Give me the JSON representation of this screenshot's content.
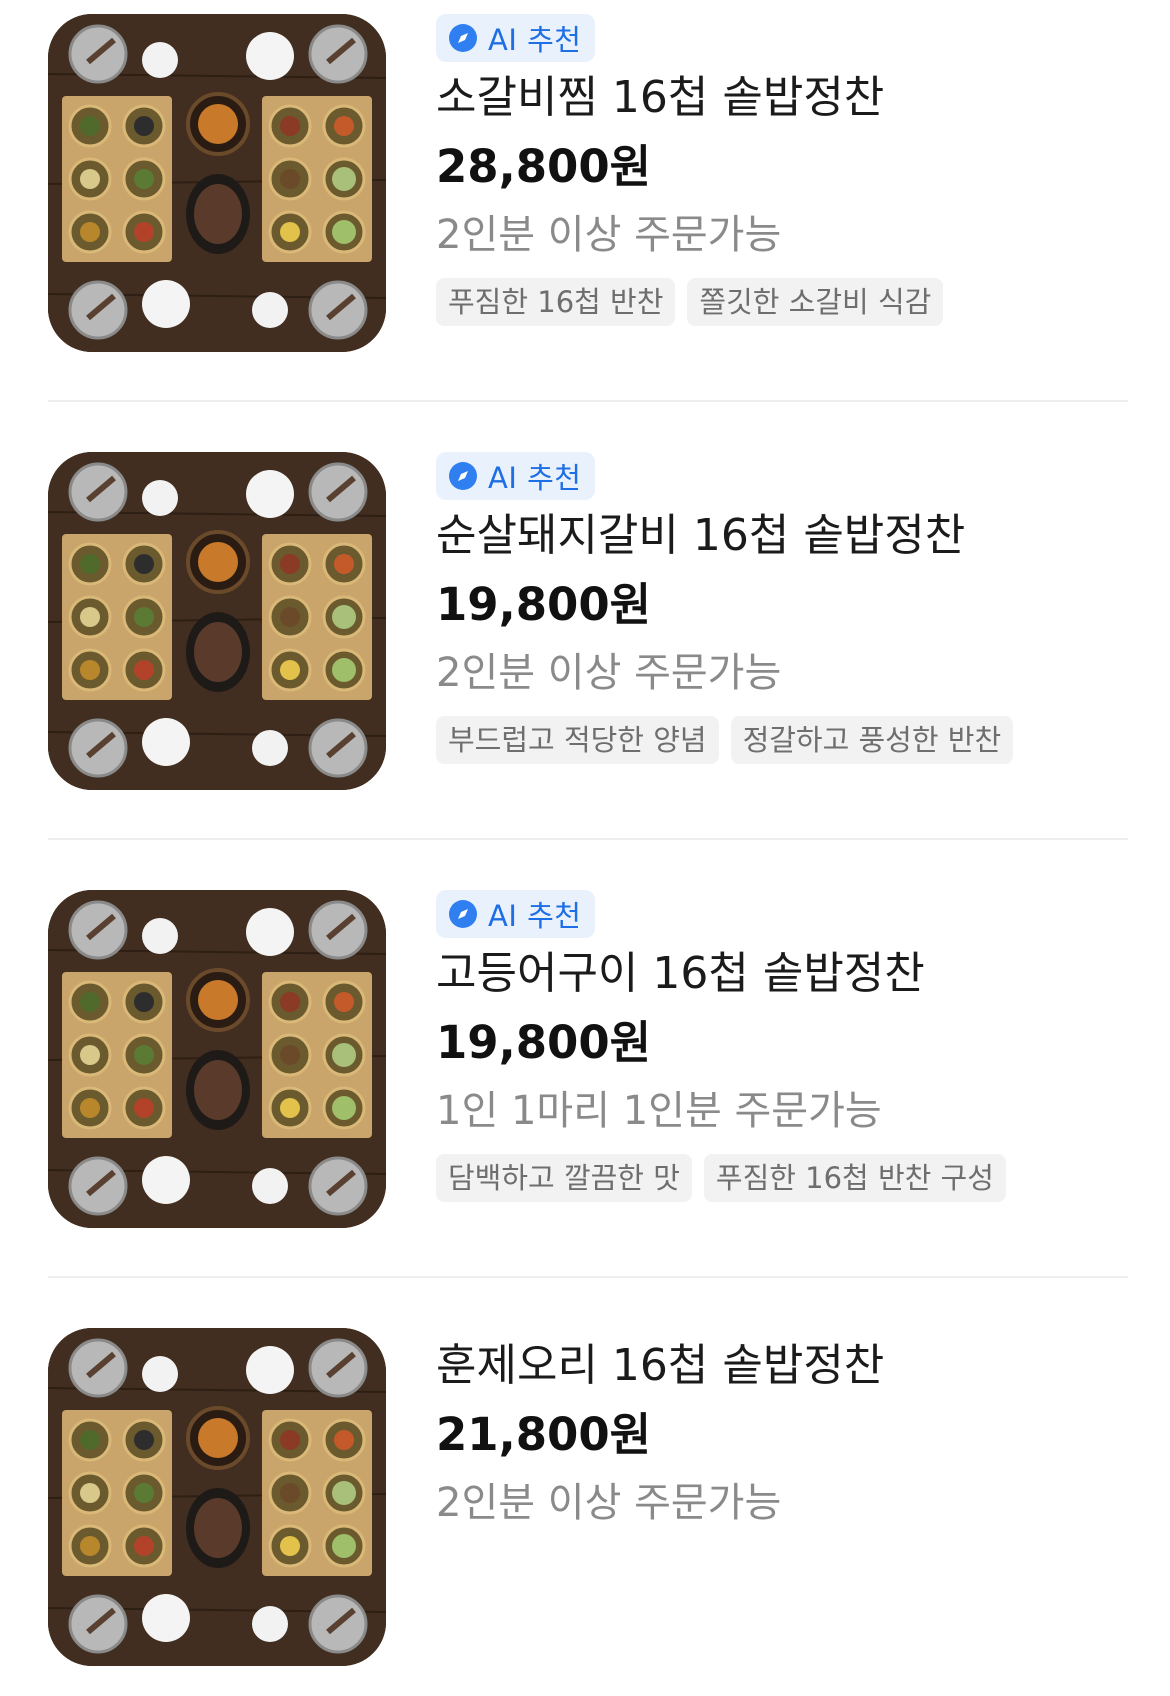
{
  "menu_items": [
    {
      "badge": "AI 추천",
      "title": "소갈비찜 16첩 솥밥정찬",
      "price": "28,800원",
      "note": "2인분 이상 주문가능",
      "tags": [
        "푸짐한 16첩 반찬",
        "쫄깃한 소갈비 식감"
      ],
      "image": "hanjeongsik-table-photo"
    },
    {
      "badge": "AI 추천",
      "title": "순살돼지갈비 16첩 솥밥정찬",
      "price": "19,800원",
      "note": "2인분 이상 주문가능",
      "tags": [
        "부드럽고 적당한 양념",
        "정갈하고 풍성한 반찬"
      ],
      "image": "hanjeongsik-table-photo"
    },
    {
      "badge": "AI 추천",
      "title": "고등어구이 16첩 솥밥정찬",
      "price": "19,800원",
      "note": "1인 1마리 1인분 주문가능",
      "tags": [
        "담백하고 깔끔한 맛",
        "푸짐한 16첩 반찬 구성"
      ],
      "image": "hanjeongsik-table-photo"
    },
    {
      "title": "훈제오리 16첩 솥밥정찬",
      "price": "21,800원",
      "note": "2인분 이상 주문가능",
      "image": "hanjeongsik-table-photo"
    }
  ],
  "colors": {
    "badge_bg": "#e9f1fd",
    "badge_text": "#1e6ee6",
    "price": "#111111",
    "note": "#8a8a8a",
    "tag_bg": "#f2f2f2",
    "tag_text": "#6e6e6e"
  },
  "icons": {
    "badge_icon": "compass-icon"
  }
}
